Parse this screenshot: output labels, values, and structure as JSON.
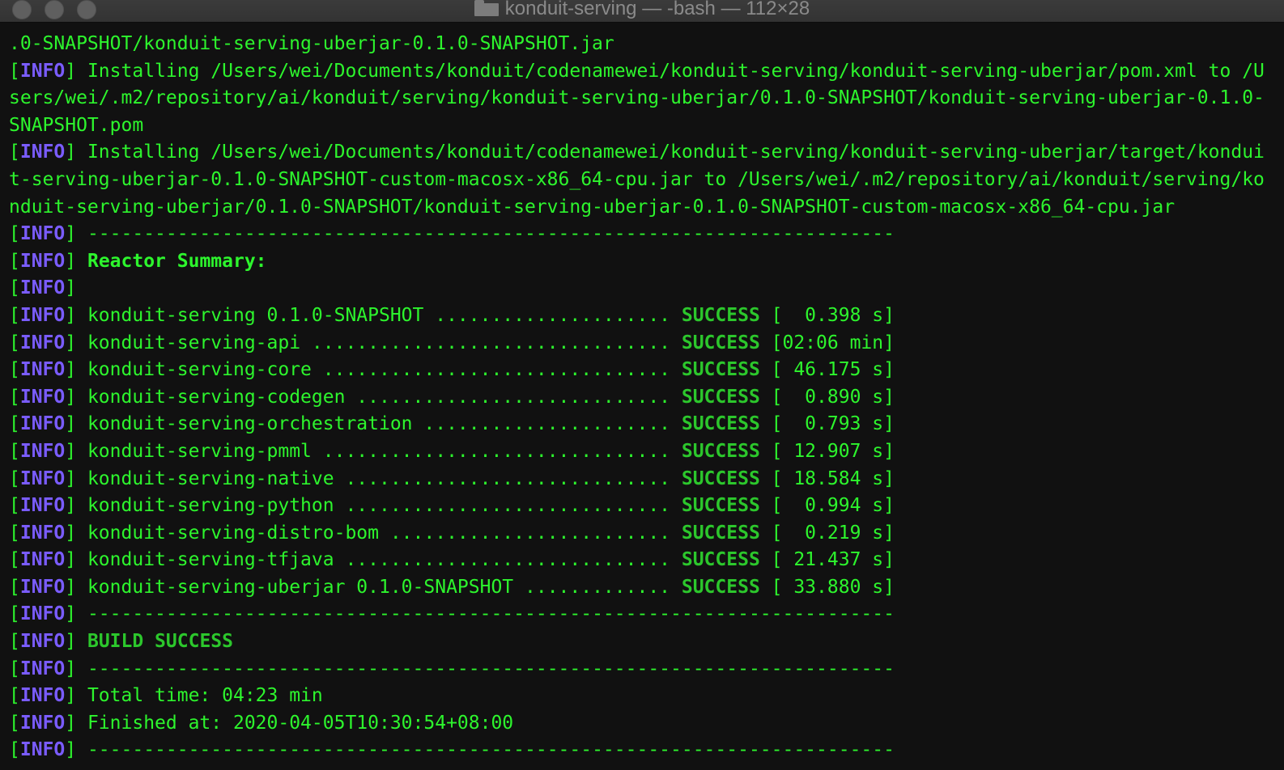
{
  "window": {
    "title": "konduit-serving — -bash — 112×28"
  },
  "terminal": {
    "info_label": "INFO",
    "lines": {
      "l0": ".0-SNAPSHOT/konduit-serving-uberjar-0.1.0-SNAPSHOT.jar",
      "l1": " Installing /Users/wei/Documents/konduit/codenamewei/konduit-serving/konduit-serving-uberjar/pom.xml to /U",
      "l2": "sers/wei/.m2/repository/ai/konduit/serving/konduit-serving-uberjar/0.1.0-SNAPSHOT/konduit-serving-uberjar-0.1.0-",
      "l3": "SNAPSHOT.pom",
      "l4": " Installing /Users/wei/Documents/konduit/codenamewei/konduit-serving/konduit-serving-uberjar/target/kondui",
      "l5": "t-serving-uberjar-0.1.0-SNAPSHOT-custom-macosx-x86_64-cpu.jar to /Users/wei/.m2/repository/ai/konduit/serving/ko",
      "l6": "nduit-serving-uberjar/0.1.0-SNAPSHOT/konduit-serving-uberjar-0.1.0-SNAPSHOT-custom-macosx-x86_64-cpu.jar",
      "separator": " ------------------------------------------------------------------------",
      "reactor_summary": "Reactor Summary:",
      "total_time": " Total time: 04:23 min",
      "finished_at": " Finished at: 2020-04-05T10:30:54+08:00",
      "build_success": "BUILD SUCCESS"
    },
    "summary": [
      {
        "module": " konduit-serving 0.1.0-SNAPSHOT ..................... ",
        "status": "SUCCESS",
        "time": " [  0.398 s]"
      },
      {
        "module": " konduit-serving-api ................................ ",
        "status": "SUCCESS",
        "time": " [02:06 min]"
      },
      {
        "module": " konduit-serving-core ............................... ",
        "status": "SUCCESS",
        "time": " [ 46.175 s]"
      },
      {
        "module": " konduit-serving-codegen ............................ ",
        "status": "SUCCESS",
        "time": " [  0.890 s]"
      },
      {
        "module": " konduit-serving-orchestration ...................... ",
        "status": "SUCCESS",
        "time": " [  0.793 s]"
      },
      {
        "module": " konduit-serving-pmml ............................... ",
        "status": "SUCCESS",
        "time": " [ 12.907 s]"
      },
      {
        "module": " konduit-serving-native ............................. ",
        "status": "SUCCESS",
        "time": " [ 18.584 s]"
      },
      {
        "module": " konduit-serving-python ............................. ",
        "status": "SUCCESS",
        "time": " [  0.994 s]"
      },
      {
        "module": " konduit-serving-distro-bom ......................... ",
        "status": "SUCCESS",
        "time": " [  0.219 s]"
      },
      {
        "module": " konduit-serving-tfjava ............................. ",
        "status": "SUCCESS",
        "time": " [ 21.437 s]"
      },
      {
        "module": " konduit-serving-uberjar 0.1.0-SNAPSHOT ............. ",
        "status": "SUCCESS",
        "time": " [ 33.880 s]"
      }
    ]
  },
  "colors": {
    "text_green": "#2df52d",
    "info_purple": "#7a5cff",
    "background": "#111111"
  }
}
